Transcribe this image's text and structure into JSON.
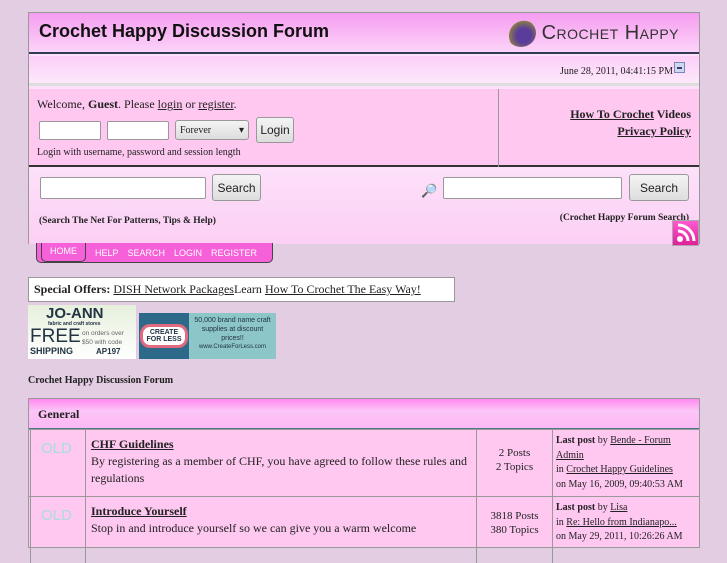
{
  "header": {
    "title": "Crochet Happy Discussion Forum",
    "logo_text": "Crochet Happy",
    "date": "June 28, 2011, 04:41:15 PM"
  },
  "login": {
    "welcome": "Welcome, ",
    "guest": "Guest",
    "please": ". Please ",
    "login_link": "login",
    "or": " or ",
    "register_link": "register",
    "period": ".",
    "session": "Forever",
    "button": "Login",
    "hint": "Login with username, password and session length"
  },
  "links": {
    "how_to": "How To Crochet",
    "videos": " Videos",
    "privacy": "Privacy Policy"
  },
  "search": {
    "button_left": "Search",
    "note_left": "(Search The Net For Patterns, Tips & Help)",
    "button_right": "Search",
    "note_right": "(Crochet Happy Forum Search)"
  },
  "nav": [
    "HOME",
    "HELP",
    "SEARCH",
    "LOGIN",
    "REGISTER"
  ],
  "offers": {
    "label": "Special Offers:",
    "link1": "DISH Network Packages",
    "text": "Learn ",
    "link2": "How To Crochet The Easy Way!"
  },
  "ads": {
    "joann": [
      "JO-ANN",
      "fabric and craft stores",
      "FREE",
      "SHIPPING",
      "on orders over $50 with code",
      "AP197"
    ],
    "cfl": [
      "CREATE",
      "FOR LESS",
      "50,000 brand name craft supplies at discount prices!!",
      "www.CreateForLess.com"
    ]
  },
  "forum_title": "Crochet Happy Discussion Forum",
  "category": "General",
  "boards": [
    {
      "icon": "OLD",
      "name": "CHF Guidelines",
      "desc": "By registering as a member of CHF, you have agreed to follow these rules and regulations",
      "posts": "2 Posts",
      "topics": "2 Topics",
      "lp_label": "Last post",
      "by": " by ",
      "author": "Bende - Forum Admin",
      "in": "in ",
      "topic": "Crochet Happy Guidelines",
      "on": "on May 16, 2009, 09:40:53 AM"
    },
    {
      "icon": "OLD",
      "name": "Introduce Yourself",
      "desc": "Stop in and introduce yourself so we can give you a warm welcome",
      "posts": "3818 Posts",
      "topics": "380 Topics",
      "lp_label": "Last post",
      "by": " by ",
      "author": "Lisa",
      "in": "in ",
      "topic": "Re: Hello from Indianapo...",
      "on": "on May 29, 2011, 10:26:26 AM"
    }
  ]
}
